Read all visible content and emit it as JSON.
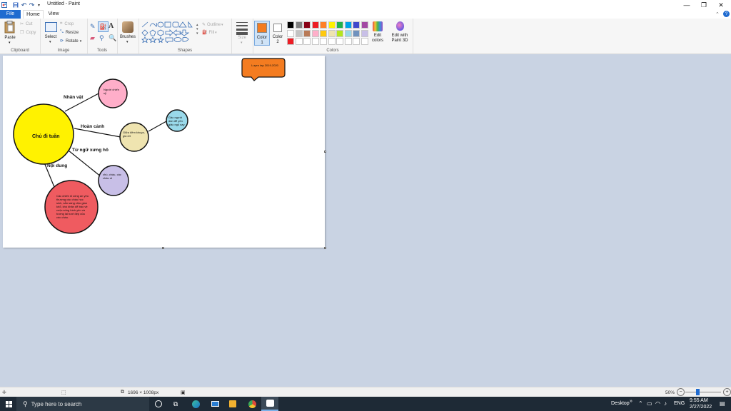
{
  "window": {
    "title": "Untitled - Paint",
    "controls": {
      "minimize": "—",
      "maximize": "❐",
      "close": "✕"
    },
    "quick_access": {
      "save": "💾",
      "undo": "↶",
      "redo": "↷",
      "customize": "▾"
    }
  },
  "tabs": [
    {
      "label": "File"
    },
    {
      "label": "Home"
    },
    {
      "label": "View"
    }
  ],
  "ribbon": {
    "clipboard": {
      "group_label": "Clipboard",
      "paste": "Paste",
      "cut": "Cut",
      "copy": "Copy"
    },
    "image": {
      "group_label": "Image",
      "select": "Select",
      "crop": "Crop",
      "resize": "Resize",
      "rotate": "Rotate"
    },
    "tools": {
      "group_label": "Tools"
    },
    "brushes": {
      "label": "Brushes"
    },
    "shapes": {
      "group_label": "Shapes",
      "outline": "Outline",
      "fill": "Fill"
    },
    "size": {
      "label": "Size"
    },
    "colors": {
      "group_label": "Colors",
      "color1_label": "Color 1",
      "color2_label": "Color 2",
      "color1_value": "#f47c20",
      "color2_value": "#ffffff",
      "edit_colors": "Edit colors",
      "edit_paint3d": "Edit with Paint 3D",
      "palette": [
        "#000000",
        "#7f7f7f",
        "#880015",
        "#ed1c24",
        "#ff7f27",
        "#fff200",
        "#22b14c",
        "#00a2e8",
        "#3f48cc",
        "#a349a4",
        "#ffffff",
        "#c3c3c3",
        "#b97a57",
        "#ffaec9",
        "#ffc90e",
        "#efe4b0",
        "#b5e61d",
        "#99d9ea",
        "#7092be",
        "#c8bfe7",
        "#ed1c24",
        "#ffffff",
        "#ffffff",
        "#ffffff",
        "#ffffff",
        "#ffffff",
        "#ffffff",
        "#ffffff",
        "#ffffff",
        "#ffffff"
      ]
    }
  },
  "diagram": {
    "central": {
      "text": "Chủ đi tuần",
      "fill": "#fff200"
    },
    "nodes": {
      "nguoi_chien_sy": {
        "text": "Người chiến sỹ",
        "fill": "#ffaec9"
      },
      "khung_canh": {
        "text": "Giữa đêm khuya, giá rét",
        "fill": "#efe4b0"
      },
      "bao_ve": {
        "text": "Gác người dân để yên giấc ngủ say",
        "fill": "#99d9ea"
      },
      "xung_ho": {
        "text": "chú, cháu, các cháu ơi",
        "fill": "#c8bfe7"
      },
      "noi_dung": {
        "text": "Các chiến sĩ công an yêu thương các cháu học sinh, sẵn sàng chịu gian khổ, khó khăn để bảo vệ cuộc sống bình yên và tương lai tươi đẹp của các cháu.",
        "fill": "#ef5b60"
      }
    },
    "labels": {
      "nhan_vat": "Nhân vật",
      "hoan_canh": "Hoàn cảnh",
      "tu_ngu": "Từ ngữ xưng hô",
      "noi_dung": "Nội dung"
    },
    "callout": {
      "text": "Luyen tap 2019-2020",
      "fill": "#f47c20"
    }
  },
  "statusbar": {
    "image_size": "1696 × 1008px",
    "zoom": "50%",
    "zoom_out": "−",
    "zoom_in": "+",
    "zoom_level": 0.5
  },
  "taskbar": {
    "search_placeholder": "Type here to search",
    "desktop": "Desktop",
    "overflow": "»",
    "language": "ENG",
    "time": "9:55 AM",
    "date": "2/27/2022"
  }
}
